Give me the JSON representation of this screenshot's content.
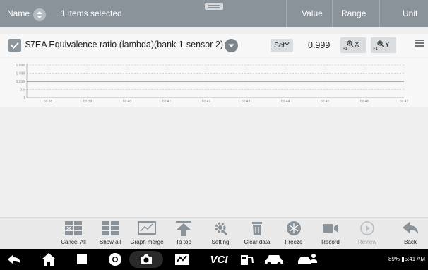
{
  "header": {
    "name_label": "Name",
    "selected_text": "1 items selected",
    "value_label": "Value",
    "range_label": "Range",
    "unit_label": "Unit"
  },
  "row": {
    "checked": true,
    "pid_label": "$7EA Equivalence ratio (lambda)(bank 1-sensor 2)",
    "sety_label": "SetY",
    "value": "0.999",
    "zoom_x_label": "X",
    "zoom_y_label": "Y",
    "zoom_multiplier": "×1"
  },
  "graph": {
    "y_ticks": [
      "1.998",
      "1.499",
      "0.999",
      "0.5",
      "0"
    ],
    "x_ticks": [
      "02:38",
      "02:39",
      "02:40",
      "02:41",
      "02:42",
      "02:43",
      "02:44",
      "02:45",
      "02:46",
      "02:47"
    ],
    "series_value": 0.999,
    "line_color": "#5a5a5a"
  },
  "toolbar": {
    "items": [
      {
        "label": "Cancel All",
        "icon": "cancel-all-icon",
        "disabled": false
      },
      {
        "label": "Show all",
        "icon": "show-all-icon",
        "disabled": false
      },
      {
        "label": "Graph merge",
        "icon": "graph-merge-icon",
        "disabled": false
      },
      {
        "label": "To top",
        "icon": "to-top-icon",
        "disabled": false
      },
      {
        "label": "Setting",
        "icon": "setting-icon",
        "disabled": false
      },
      {
        "label": "Clear data",
        "icon": "clear-data-icon",
        "disabled": false
      },
      {
        "label": "Freeze",
        "icon": "freeze-icon",
        "disabled": false
      },
      {
        "label": "Record",
        "icon": "record-icon",
        "disabled": false
      },
      {
        "label": "Review",
        "icon": "review-icon",
        "disabled": true
      },
      {
        "label": "Back",
        "icon": "back-icon",
        "disabled": false
      }
    ]
  },
  "navbar": {
    "status_text": "89% ▮5:41 AM",
    "vci_label": "VCI"
  },
  "colors": {
    "header_bg": "#8a929a",
    "icon_gray": "#7d858c",
    "navbar_bg": "#000000"
  }
}
